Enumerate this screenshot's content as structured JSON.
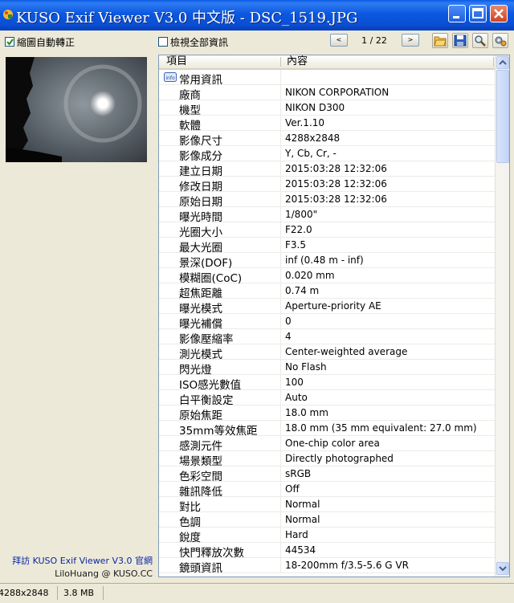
{
  "window": {
    "title": "KUSO Exif Viewer V3.0 中文版 - DSC_1519.JPG"
  },
  "toolbar": {
    "auto_rotate_label": "縮圖自動轉正",
    "auto_rotate_checked": true,
    "show_all_label": "檢視全部資訊",
    "show_all_checked": false,
    "page_indicator": "1 / 22",
    "prev_glyph": "<",
    "next_glyph": ">"
  },
  "list": {
    "col_item": "項目",
    "col_content": "內容",
    "group_label": "常用資訊",
    "rows": [
      {
        "k": "廠商",
        "v": "NIKON CORPORATION"
      },
      {
        "k": "機型",
        "v": "NIKON D300"
      },
      {
        "k": "軟體",
        "v": "Ver.1.10"
      },
      {
        "k": "影像尺寸",
        "v": "4288x2848"
      },
      {
        "k": "影像成分",
        "v": "Y, Cb, Cr, -"
      },
      {
        "k": "建立日期",
        "v": "2015:03:28 12:32:06"
      },
      {
        "k": "修改日期",
        "v": "2015:03:28 12:32:06"
      },
      {
        "k": "原始日期",
        "v": "2015:03:28 12:32:06"
      },
      {
        "k": "曝光時間",
        "v": "1/800\""
      },
      {
        "k": "光圈大小",
        "v": "F22.0"
      },
      {
        "k": "最大光圈",
        "v": "F3.5"
      },
      {
        "k": "景深(DOF)",
        "v": "inf (0.48 m - inf)"
      },
      {
        "k": "模糊圈(CoC)",
        "v": "0.020 mm"
      },
      {
        "k": "超焦距離",
        "v": "0.74 m"
      },
      {
        "k": "曝光模式",
        "v": "Aperture-priority AE"
      },
      {
        "k": "曝光補償",
        "v": "0"
      },
      {
        "k": "影像壓縮率",
        "v": "4"
      },
      {
        "k": "測光模式",
        "v": "Center-weighted average"
      },
      {
        "k": "閃光燈",
        "v": "No Flash"
      },
      {
        "k": "ISO感光數值",
        "v": "100"
      },
      {
        "k": "白平衡設定",
        "v": "Auto"
      },
      {
        "k": "原始焦距",
        "v": "18.0 mm"
      },
      {
        "k": "35mm等效焦距",
        "v": "18.0 mm (35 mm equivalent: 27.0 mm)"
      },
      {
        "k": "感測元件",
        "v": "One-chip color area"
      },
      {
        "k": "場景類型",
        "v": "Directly photographed"
      },
      {
        "k": "色彩空間",
        "v": "sRGB"
      },
      {
        "k": "雜訊降低",
        "v": "Off"
      },
      {
        "k": "對比",
        "v": "Normal"
      },
      {
        "k": "色調",
        "v": "Normal"
      },
      {
        "k": "銳度",
        "v": "Hard"
      },
      {
        "k": "快門釋放次數",
        "v": "44534"
      },
      {
        "k": "鏡頭資訊",
        "v": "18-200mm f/3.5-5.6 G VR"
      }
    ]
  },
  "sidebar": {
    "visit_link": "拜訪 KUSO Exif Viewer V3.0 官網",
    "credit": "LiloHuang @ KUSO.CC"
  },
  "statusbar": {
    "dimensions": "4288x2848",
    "filesize": "3.8 MB"
  },
  "colors": {
    "title_bar": "#0a5ce6",
    "link": "#0b27a0",
    "close_button": "#cf4220"
  }
}
